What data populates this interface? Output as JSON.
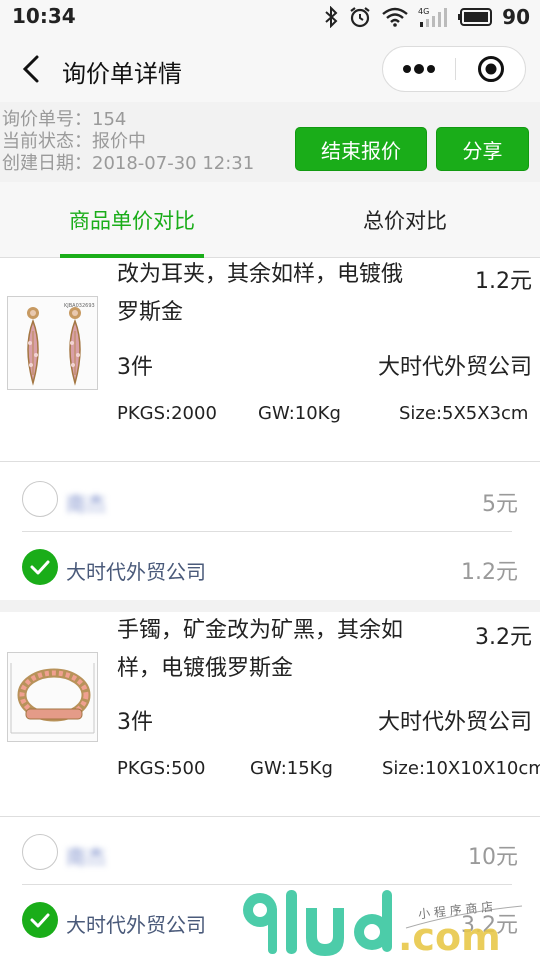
{
  "status_bar": {
    "time": "10:34",
    "battery": "90",
    "network_badge": "4G",
    "icons": [
      "bluetooth-icon",
      "alarm-icon",
      "wifi-icon",
      "signal-icon",
      "battery-icon"
    ]
  },
  "nav": {
    "title": "询价单详情",
    "icons": [
      "back-icon",
      "more-icon",
      "target-icon"
    ]
  },
  "info": {
    "number": "询价单号：154",
    "status": "当前状态：报价中",
    "created": "创建日期：2018-07-30 12:31",
    "end_button": "结束报价",
    "share_button": "分享"
  },
  "tabs": {
    "unit": "商品单价对比",
    "total": "总价对比",
    "active": "unit"
  },
  "items": [
    {
      "title": "改为耳夹，其余如样，电镀俄罗斯金",
      "price": "1.2元",
      "qty": "3件",
      "supplier": "大时代外贸公司",
      "pkgs": "PKGS:2000",
      "gw": "GW:10Kg",
      "size": "Size:5X5X3cm",
      "quotes": [
        {
          "name": "南杰",
          "price": "5元",
          "selected": false
        },
        {
          "name": "大时代外贸公司",
          "price": "1.2元",
          "selected": true
        }
      ]
    },
    {
      "title": "手镯，矿金改为矿黑，其余如样，电镀俄罗斯金",
      "price": "3.2元",
      "qty": "3件",
      "supplier": "大时代外贸公司",
      "pkgs": "PKGS:500",
      "gw": "GW:15Kg",
      "size": "Size:10X10X10cm",
      "quotes": [
        {
          "name": "南杰",
          "price": "10元",
          "selected": false
        },
        {
          "name": "大时代外贸公司",
          "price": "3.2元",
          "selected": true
        }
      ]
    }
  ],
  "watermark": {
    "logo": "91ud.com",
    "tagline": "小程序商店"
  },
  "colors": {
    "accent": "#1aad19",
    "muted_text": "#9a9a9a",
    "background": "#f2f2f2"
  }
}
